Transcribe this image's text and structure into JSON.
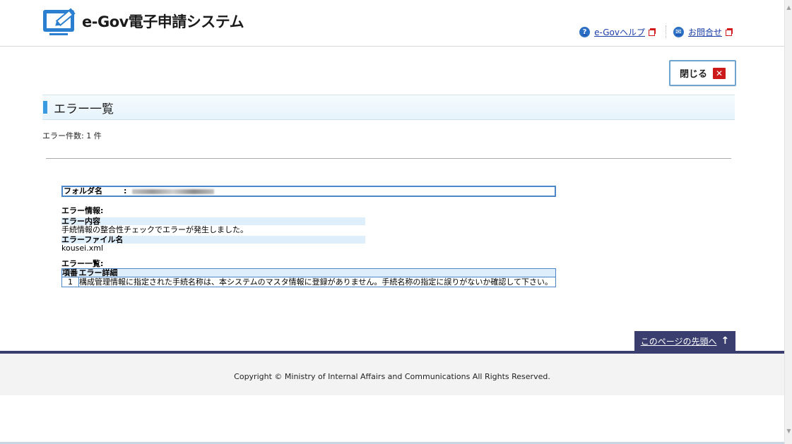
{
  "header": {
    "app_title": "e-Gov電子申請システム",
    "help_link": "e-Govヘルプ",
    "contact_link": "お問合せ"
  },
  "close_button": {
    "label": "閉じる",
    "icon": "close-icon"
  },
  "section": {
    "title": "エラー一覧"
  },
  "summary": {
    "error_count": "エラー件数: 1 件"
  },
  "report": {
    "folder_label": "フォルダ名",
    "folder_colon": ":",
    "error_info_label": "エラー情報:",
    "error_content_head": "エラー内容",
    "error_content_value": "手続情報の整合性チェックでエラーが発生しました。",
    "error_file_head": "エラーファイル名",
    "error_file_value": "kousei.xml",
    "error_list_label": "エラー一覧:",
    "table_headers": {
      "no": "項番",
      "detail": "エラー詳細"
    },
    "rows": [
      {
        "no": "1",
        "detail": "構成管理情報に指定された手続名称は、本システムのマスタ情報に登録がありません。手続名称の指定に誤りがないか確認して下さい。"
      }
    ]
  },
  "page_top": {
    "label": "このページの先頭へ",
    "arrow": "↑"
  },
  "footer": {
    "copyright": "Copyright © Ministry of Internal Affairs and Communications All Rights Reserved."
  },
  "colors": {
    "brand_blue": "#2b6fc4",
    "accent_red": "#cc1a1a",
    "footer_navy": "#3a3e6e",
    "title_bar": "#3b9be0"
  }
}
